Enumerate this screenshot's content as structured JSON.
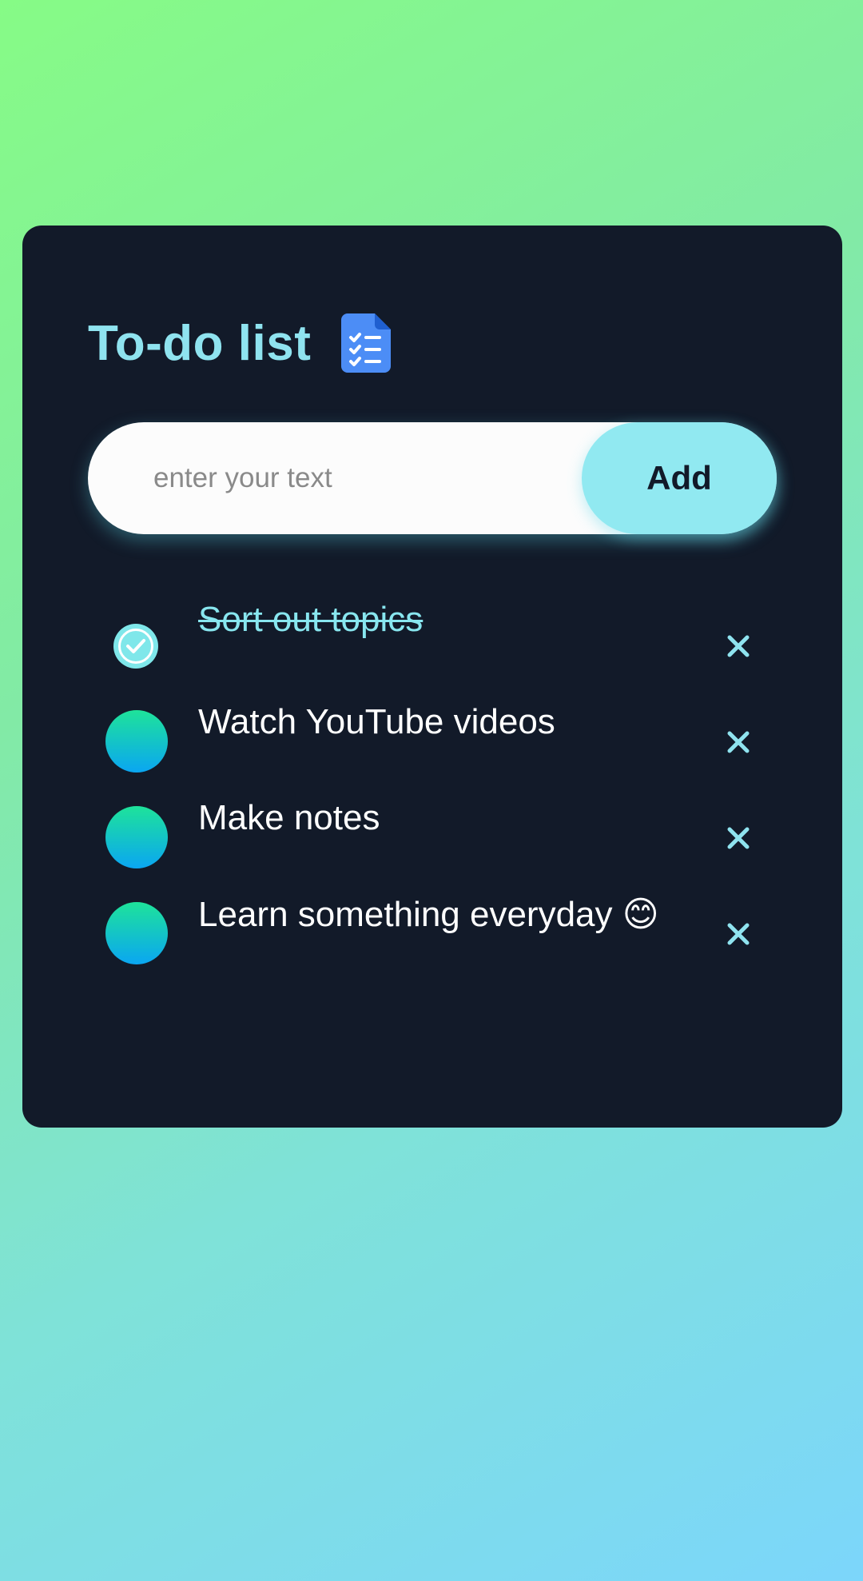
{
  "header": {
    "title": "To-do list",
    "icon": "checklist-document-icon"
  },
  "form": {
    "input_value": "",
    "input_placeholder": "enter your text",
    "add_label": "Add"
  },
  "tasks": [
    {
      "text": "Sort out topics",
      "completed": true
    },
    {
      "text": "Watch YouTube videos",
      "completed": false
    },
    {
      "text": "Make notes",
      "completed": false
    },
    {
      "text": "Learn something everyday 😊",
      "completed": false
    }
  ],
  "colors": {
    "card_background": "#121a29",
    "accent": "#91e9f1",
    "title": "#8fe3ef",
    "icon_blue": "#4c8df6",
    "circle_gradient_top": "#1ee39a",
    "circle_gradient_bottom": "#0aa6f2"
  }
}
